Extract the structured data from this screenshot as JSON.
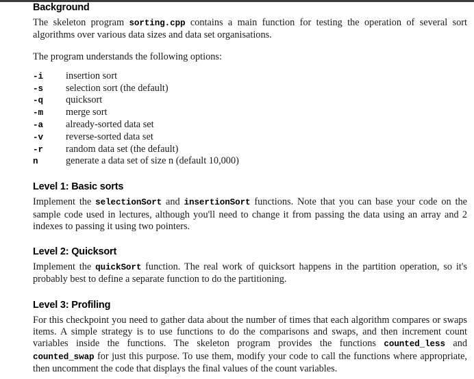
{
  "document": {
    "sections": [
      {
        "id": "background",
        "heading": "Background",
        "paragraphs": [
          {
            "id": "background-intro",
            "segments": [
              {
                "type": "text",
                "value": "The skeleton program "
              },
              {
                "type": "code",
                "value": "sorting.cpp"
              },
              {
                "type": "text",
                "value": " contains a main function for testing the operation of several sort algorithms over various data sizes and data set organisations."
              }
            ]
          },
          {
            "id": "options-intro",
            "segments": [
              {
                "type": "text",
                "value": "The program understands the following options:"
              }
            ]
          }
        ],
        "options": [
          {
            "flag": "-i",
            "description": "insertion sort"
          },
          {
            "flag": "-s",
            "description": "selection sort (the default)"
          },
          {
            "flag": "-q",
            "description": "quicksort"
          },
          {
            "flag": "-m",
            "description": "merge sort"
          },
          {
            "flag": "-a",
            "description": "already-sorted data set"
          },
          {
            "flag": "-v",
            "description": "reverse-sorted data set"
          },
          {
            "flag": "-r",
            "description": "random data set (the default)"
          },
          {
            "flag": "n",
            "description": "generate a data set of size n (default 10,000)"
          }
        ]
      },
      {
        "id": "level-1",
        "heading": "Level 1: Basic sorts",
        "paragraphs": [
          {
            "id": "level-1-body",
            "segments": [
              {
                "type": "text",
                "value": "Implement the "
              },
              {
                "type": "code",
                "value": "selectionSort"
              },
              {
                "type": "text",
                "value": " and "
              },
              {
                "type": "code",
                "value": "insertionSort"
              },
              {
                "type": "text",
                "value": " functions. Note that you can base your code on the sample code used in lectures, although you'll need to change it from passing the data using an array and 2 indexes to passing it using two pointers."
              }
            ]
          }
        ]
      },
      {
        "id": "level-2",
        "heading": "Level 2: Quicksort",
        "paragraphs": [
          {
            "id": "level-2-body",
            "segments": [
              {
                "type": "text",
                "value": "Implement the "
              },
              {
                "type": "code",
                "value": "quickSort"
              },
              {
                "type": "text",
                "value": " function. The real work of quicksort happens in the partition operation, so it's probably best to define a separate function to do the partitioning."
              }
            ]
          }
        ]
      },
      {
        "id": "level-3",
        "heading": "Level 3: Profiling",
        "paragraphs": [
          {
            "id": "level-3-body",
            "segments": [
              {
                "type": "text",
                "value": "For this checkpoint you need to gather data about the number of times that each algorithm compares or swaps items. A simple strategy is to use functions to do the comparisons and swaps, and then increment count variables inside the functions. The skeleton program provides the functions "
              },
              {
                "type": "code",
                "value": "counted_less"
              },
              {
                "type": "text",
                "value": " and "
              },
              {
                "type": "code",
                "value": "counted_swap"
              },
              {
                "type": "text",
                "value": " for just this purpose. To use them, modify your code to call the functions where appropriate, then uncomment the code that displays the final values of the count variables."
              }
            ]
          }
        ]
      }
    ]
  },
  "colors": {
    "top_bar": "#3a3a3a",
    "page_background": "#ffffff",
    "heading_text": "#000000",
    "body_text": "#1a1a1a"
  }
}
